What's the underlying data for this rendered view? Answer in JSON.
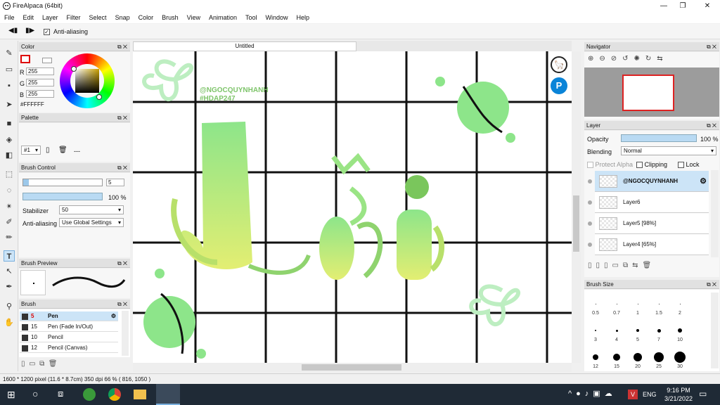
{
  "window": {
    "title": "FireAlpaca (64bit)",
    "min": "—",
    "max": "❐",
    "close": "✕"
  },
  "menu": [
    "File",
    "Edit",
    "Layer",
    "Filter",
    "Select",
    "Snap",
    "Color",
    "Brush",
    "View",
    "Animation",
    "Tool",
    "Window",
    "Help"
  ],
  "toolbar": {
    "anti_aliasing_label": "Anti-aliasing",
    "anti_aliasing_checked": true
  },
  "tools": [
    "pen-tool",
    "eraser-tool",
    "dot-tool",
    "move-tool",
    "fill-rect-tool",
    "bucket-tool",
    "gradient-tool",
    "select-tool",
    "lasso-tool",
    "magic-wand-tool",
    "select-pen-tool",
    "select-eraser-tool",
    "text-tool",
    "operation-tool",
    "eyedropper-tool",
    "hand-tool"
  ],
  "color_panel": {
    "title": "Color",
    "r_label": "R",
    "g_label": "G",
    "b_label": "B",
    "r": "255",
    "g": "255",
    "b": "255",
    "hex": "#FFFFFF"
  },
  "palette_panel": {
    "title": "Palette",
    "set": "#1",
    "dash": "---"
  },
  "brush_control": {
    "title": "Brush Control",
    "size": "5",
    "opacity": "100 %",
    "stabilizer_label": "Stabilizer",
    "stabilizer": "50",
    "aa_label": "Anti-aliasing",
    "aa": "Use Global Settings"
  },
  "brush_preview": {
    "title": "Brush Preview"
  },
  "brush_panel": {
    "title": "Brush",
    "items": [
      {
        "size": "5",
        "name": "Pen",
        "selected": true
      },
      {
        "size": "15",
        "name": "Pen (Fade In/Out)",
        "selected": false
      },
      {
        "size": "10",
        "name": "Pencil",
        "selected": false
      },
      {
        "size": "12",
        "name": "Pencil (Canvas)",
        "selected": false
      }
    ]
  },
  "document": {
    "tab": "Untitled"
  },
  "canvas_text": {
    "handle": "@NGOCQUYNHANH",
    "tag": "#HDAP247"
  },
  "navigator": {
    "title": "Navigator"
  },
  "layer_panel": {
    "title": "Layer",
    "opacity_label": "Opacity",
    "opacity": "100 %",
    "blending_label": "Blending",
    "blending": "Normal",
    "protect_alpha": "Protect Alpha",
    "clipping": "Clipping",
    "lock": "Lock",
    "layers": [
      {
        "name": "@NGOCQUYNHANH",
        "selected": true
      },
      {
        "name": "Layer6",
        "selected": false
      },
      {
        "name": "Layer5 [98%]",
        "selected": false
      },
      {
        "name": "Layer4 [65%]",
        "selected": false
      }
    ]
  },
  "brush_size": {
    "title": "Brush Size",
    "sizes": [
      "0.5",
      "0.7",
      "1",
      "1.5",
      "2",
      "3",
      "4",
      "5",
      "7",
      "10",
      "12",
      "15",
      "20",
      "25",
      "30"
    ]
  },
  "status": "1600 * 1200 pixel   (11.6 * 8.7cm)   350 dpi   66 %   ( 816, 1050 )",
  "taskbar": {
    "lang": "ENG",
    "time": "9:16 PM",
    "date": "3/21/2022"
  },
  "colors": {
    "accent_blue": "#0078d7",
    "lime": "#d8ec6a",
    "green": "#7fe07a"
  }
}
